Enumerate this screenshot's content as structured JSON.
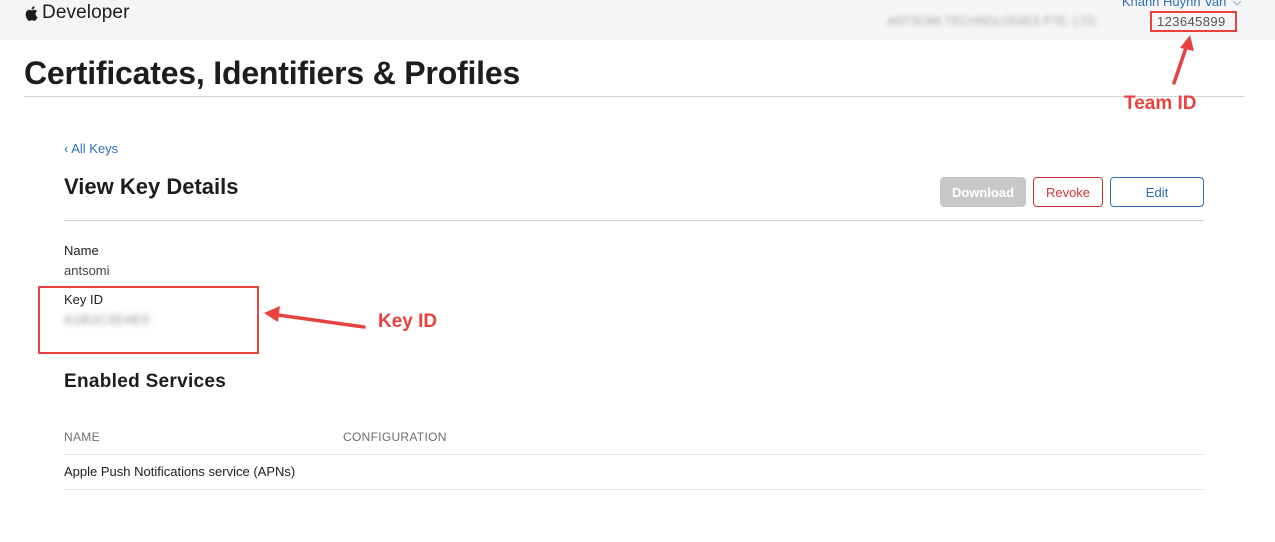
{
  "header": {
    "brand": "Developer",
    "account_name": "Khanh Huynh Van",
    "org_name": "ANTSOMI TECHNOLOGIES PTE. LTD.",
    "team_id": "123645899"
  },
  "page": {
    "title": "Certificates, Identifiers & Profiles"
  },
  "key_details": {
    "back_link": "‹ All Keys",
    "title": "View Key Details",
    "buttons": {
      "download": "Download",
      "revoke": "Revoke",
      "edit": "Edit"
    },
    "name_label": "Name",
    "name_value": "antsomi",
    "key_id_label": "Key ID",
    "key_id_value": "A1B2C3D4E5"
  },
  "services": {
    "title": "Enabled Services",
    "columns": [
      "NAME",
      "CONFIGURATION"
    ],
    "rows": [
      {
        "name": "Apple Push Notifications service (APNs)",
        "configuration": ""
      }
    ]
  },
  "annotations": {
    "team_label": "Team ID",
    "key_label": "Key ID",
    "color": "#e8423f"
  },
  "colors": {
    "link": "#2f6fb3",
    "revoke": "#d13438",
    "download_disabled": "#c8c8c8",
    "topbar": "#f5f5f7"
  }
}
